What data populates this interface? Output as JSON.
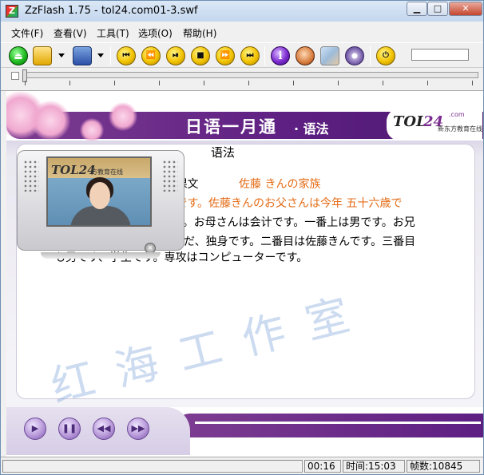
{
  "window": {
    "title": "ZzFlash 1.75  - tol24.com01-3.swf",
    "icon_letter": "Z",
    "minimize": "▁",
    "maximize": "□",
    "close": "✕"
  },
  "menu": [
    {
      "label": "文件(F)"
    },
    {
      "label": "查看(V)"
    },
    {
      "label": "工具(T)"
    },
    {
      "label": "选项(O)"
    },
    {
      "label": "帮助(H)"
    }
  ],
  "toolbar": {
    "buttons": [
      {
        "name": "eject-icon",
        "glyph": "⏏"
      },
      {
        "name": "open-folder-icon",
        "glyph": ""
      },
      {
        "name": "save-icon",
        "glyph": ""
      },
      {
        "name": "skip-start-icon",
        "glyph": "⏮"
      },
      {
        "name": "rewind-icon",
        "glyph": "⏪"
      },
      {
        "name": "play-pause-icon",
        "glyph": "⏯"
      },
      {
        "name": "stop-icon",
        "glyph": "■"
      },
      {
        "name": "fast-forward-icon",
        "glyph": "⏩"
      },
      {
        "name": "skip-end-icon",
        "glyph": "⏭"
      },
      {
        "name": "info-icon",
        "glyph": "i"
      },
      {
        "name": "face-icon",
        "glyph": ""
      },
      {
        "name": "image-icon",
        "glyph": ""
      },
      {
        "name": "disc-icon",
        "glyph": ""
      },
      {
        "name": "exit-icon",
        "glyph": "⏻"
      }
    ]
  },
  "flash": {
    "banner_title": "日语一月通",
    "banner_sub": "· 语法",
    "logo_tol": "TOL",
    "logo_num": "24",
    "logo_com": ".com",
    "logo_cn": "新东方教育在线",
    "section_title": "语法",
    "lines": [
      {
        "text": "课 课文",
        "color": "black"
      },
      {
        "text": "佐藤 きんの家族",
        "color": "orange"
      },
      {
        "text": "族 です。佐藤きんのお父さんは今年  五十六歳で",
        "color": "orange"
      },
      {
        "text": "です。お母さんは会计です。一番上は男です。お兄",
        "color": "black"
      },
      {
        "text": "。まだ、独身です。二番目は佐藤きんです。三番目",
        "color": "black"
      },
      {
        "text": "も男です、学生です。専攻はコンピューターです。",
        "color": "black"
      }
    ],
    "tv_logo": "TOL24",
    "tv_logo_cn": "方教育在线",
    "tv_close": "×",
    "controls": [
      {
        "name": "play-button",
        "glyph": "▶"
      },
      {
        "name": "pause-button",
        "glyph": "❚❚"
      },
      {
        "name": "rewind-button",
        "glyph": "◀◀"
      },
      {
        "name": "forward-button",
        "glyph": "▶▶"
      }
    ],
    "watermark": "红海工作室"
  },
  "status": {
    "elapsed": "00:16",
    "time": "时间:15:03",
    "frames": "帧数:10845"
  }
}
